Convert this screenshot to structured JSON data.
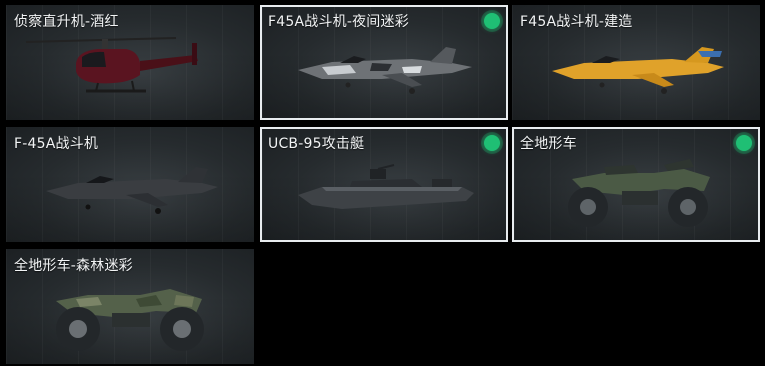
{
  "vehicles": [
    {
      "title": "侦察直升机-酒红",
      "selected": false,
      "equipped": false,
      "art": "helicopter-red"
    },
    {
      "title": "F45A战斗机-夜间迷彩",
      "selected": true,
      "equipped": true,
      "art": "jet-camo"
    },
    {
      "title": "F45A战斗机-建造",
      "selected": false,
      "equipped": false,
      "art": "jet-yellow"
    },
    {
      "title": "F-45A战斗机",
      "selected": false,
      "equipped": false,
      "art": "jet-dark"
    },
    {
      "title": "UCB-95攻击艇",
      "selected": true,
      "equipped": true,
      "art": "boat"
    },
    {
      "title": "全地形车",
      "selected": true,
      "equipped": true,
      "art": "atv"
    },
    {
      "title": "全地形车-森林迷彩",
      "selected": false,
      "equipped": false,
      "art": "atv-camo"
    }
  ],
  "colors": {
    "background": "#000000",
    "card": "#2a2f32",
    "selected_border": "#e8ecef",
    "equipped_badge": "#1fbf74"
  }
}
